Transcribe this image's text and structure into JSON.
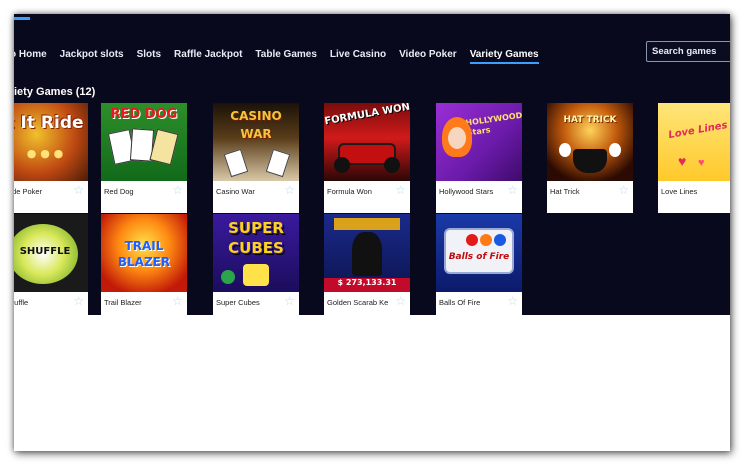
{
  "nav": {
    "items": [
      "o Home",
      "Jackpot slots",
      "Slots",
      "Raffle Jackpot",
      "Table Games",
      "Live Casino",
      "Video Poker",
      "Variety Games"
    ],
    "active_index": 7
  },
  "search": {
    "placeholder": "Search games"
  },
  "section": {
    "title": "iety Games (12)"
  },
  "games": [
    {
      "name": "Ride Poker",
      "art_text": "t It Ride"
    },
    {
      "name": "Red Dog",
      "art_text": "RED DOG"
    },
    {
      "name": "Casino War",
      "art_text": "CASINO WAR"
    },
    {
      "name": "Formula Won",
      "art_text": "FORMULA WON"
    },
    {
      "name": "Hollywood Stars",
      "art_text": "HOLLYWOOD Stars"
    },
    {
      "name": "Hat Trick",
      "art_text": "HAT TRICK"
    },
    {
      "name": "Love Lines",
      "art_text": "Love Lines"
    },
    {
      "name": "Shuffle",
      "art_text": "SHUFFLE"
    },
    {
      "name": "Trail Blazer",
      "art_text": "TRAIL BLAZER"
    },
    {
      "name": "Super Cubes",
      "art_text": "SUPER CUBES"
    },
    {
      "name": "Golden Scarab Ke",
      "art_text": "$ 273,133.31"
    },
    {
      "name": "Balls Of Fire",
      "art_text": "Balls of Fire"
    }
  ],
  "colors": {
    "background": "#08091c",
    "accent": "#3aa0ff",
    "favorite_star": "#b9dbea"
  },
  "icons": {
    "favorite": "star-outline-icon"
  }
}
